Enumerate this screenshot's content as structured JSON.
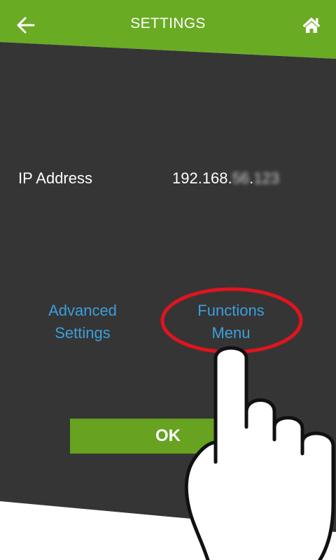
{
  "header": {
    "title": "SETTINGS",
    "back_icon": "arrow-left-icon",
    "home_icon": "home-icon"
  },
  "network": {
    "ip_label": "IP Address",
    "ip_visible_prefix": "192.168.",
    "ip_blurred_octet_3": "56",
    "ip_dot": ".",
    "ip_blurred_octet_4": "123"
  },
  "links": {
    "advanced_line1": "Advanced",
    "advanced_line2": "Settings",
    "functions_line1": "Functions",
    "functions_line2": "Menu"
  },
  "actions": {
    "ok_label": "OK"
  },
  "annotations": {
    "highlight": "red-ellipse",
    "pointer_icon": "hand-pointer-icon"
  },
  "colors": {
    "header_green": "#6aab24",
    "panel_dark": "#353535",
    "link_blue": "#3aa0dd",
    "ok_green": "#67a220",
    "highlight_red": "#e0141e"
  }
}
